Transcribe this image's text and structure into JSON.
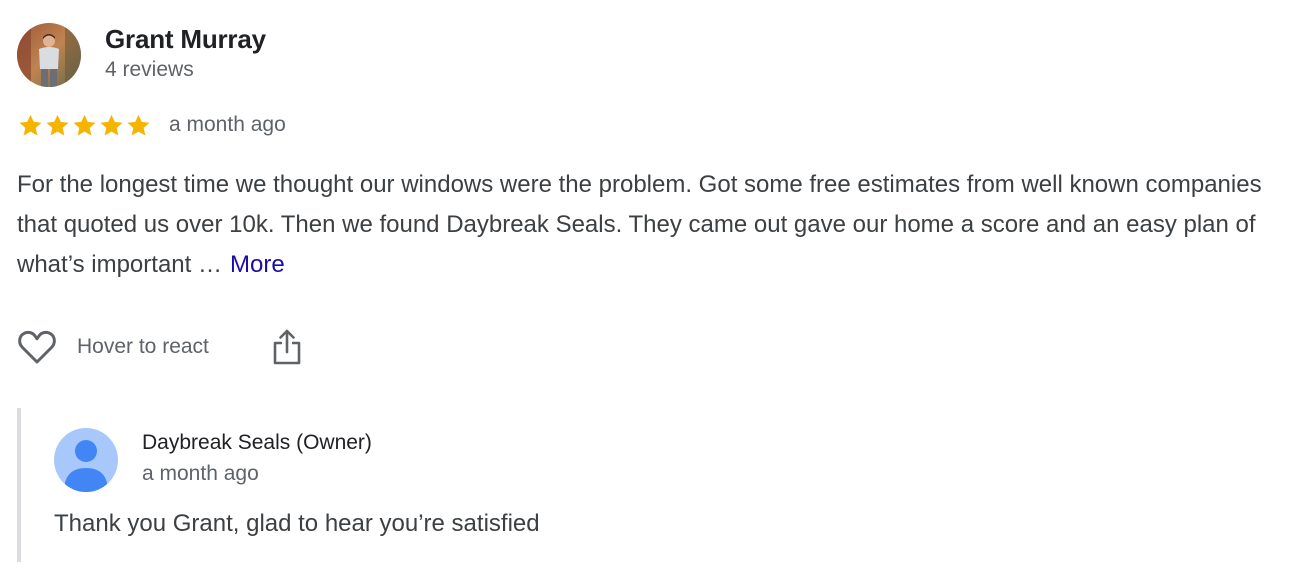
{
  "reviewer": {
    "name": "Grant Murray",
    "review_count": "4 reviews",
    "avatar_icon": "profile-photo"
  },
  "rating": {
    "stars": 5,
    "max_stars": 5,
    "star_color": "#f4b400",
    "date": "a month ago"
  },
  "review": {
    "text": "For the longest time we thought our windows were the problem. Got some free estimates from well known companies that quoted us over 10k. Then we found Daybreak Seals. They came out gave our home a score and an easy plan of what’s important …",
    "more_label": "More",
    "link_color": "#1a0dab"
  },
  "actions": {
    "react_label": "Hover to react",
    "heart_icon": "heart-outline-icon",
    "share_icon": "share-icon"
  },
  "owner_reply": {
    "name": "Daybreak Seals (Owner)",
    "date": "a month ago",
    "text": "Thank you Grant, glad to hear you’re satisfied",
    "avatar_icon": "default-person-icon",
    "avatar_bg": "#a8c7fa",
    "avatar_fg": "#4285f4"
  }
}
